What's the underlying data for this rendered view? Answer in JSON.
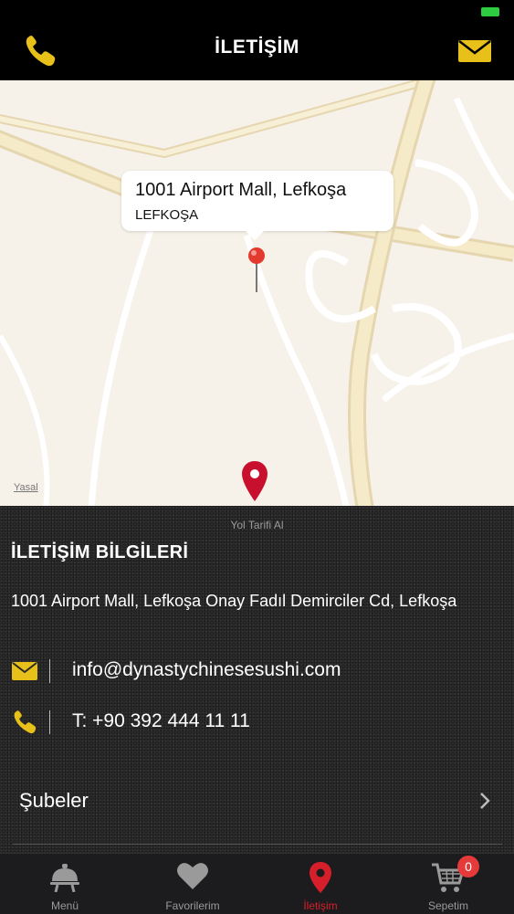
{
  "header": {
    "title": "İLETİŞİM",
    "phone_icon": "phone-icon",
    "mail_icon": "envelope-icon"
  },
  "map": {
    "callout_title": "1001 Airport Mall, Lefkoşa",
    "callout_subtitle": "LEFKOŞA",
    "legal_link": "Yasal"
  },
  "contact": {
    "directions_link": "Yol Tarifi Al",
    "section_title": "İLETİŞİM BİLGİLERİ",
    "address": "1001 Airport Mall, Lefkoşa Onay Fadıl Demirciler Cd, Lefkoşa",
    "email": "info@dynastychinesesushi.com",
    "phone": "T: +90 392 444 11 11",
    "branches_label": "Şubeler"
  },
  "tabs": [
    {
      "label": "Menü",
      "icon": "waiter-cloche-icon"
    },
    {
      "label": "Favorilerim",
      "icon": "heart-icon"
    },
    {
      "label": "İletişim",
      "icon": "location-pin-icon"
    },
    {
      "label": "Sepetim",
      "icon": "cart-icon",
      "badge": "0"
    }
  ],
  "colors": {
    "accent_yellow": "#e7c019",
    "active_red": "#d71f2c",
    "badge_red": "#e43a3a"
  }
}
